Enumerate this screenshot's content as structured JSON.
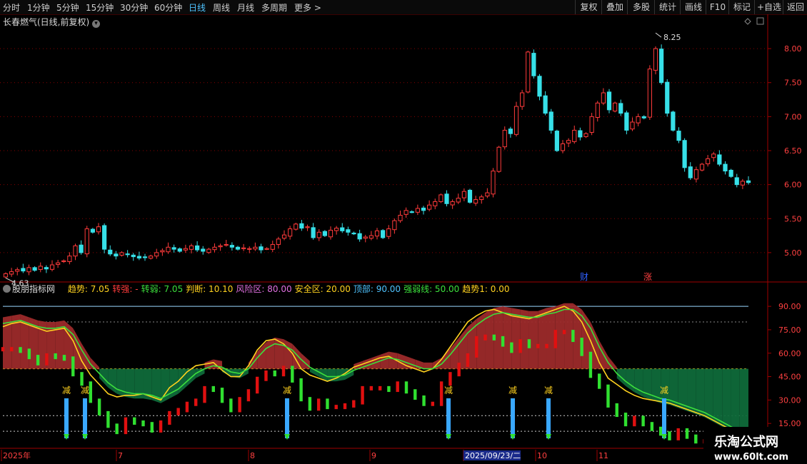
{
  "toolbar": {
    "left": [
      "分时",
      "1分钟",
      "5分钟",
      "15分钟",
      "30分钟",
      "60分钟",
      "日线",
      "周线",
      "月线",
      "多周期",
      "更多 >"
    ],
    "active": "日线",
    "right": [
      "复权",
      "叠加",
      "多股",
      "统计",
      "画线",
      "F10",
      "标记",
      "+自选",
      "返回"
    ]
  },
  "stock": {
    "title": "长春燃气(日线,前复权)"
  },
  "price_panel": {
    "yticks": [
      "8.00",
      "7.50",
      "7.00",
      "6.50",
      "6.00",
      "5.50",
      "5.00"
    ],
    "max_label": "8.25",
    "min_label": "4.63",
    "tags": [
      "财",
      "涨"
    ]
  },
  "indicator": {
    "name": "股朋指标网",
    "labels": [
      {
        "text": "趋势: 7.05",
        "color": "#ffd21f"
      },
      {
        "text": "转强: -",
        "color": "#ff3b3b"
      },
      {
        "text": "转弱: 7.05",
        "color": "#3ce03c"
      },
      {
        "text": "判断: 10.10",
        "color": "#ffd21f"
      },
      {
        "text": "风险区: 80.00",
        "color": "#e070e0"
      },
      {
        "text": "安全区: 20.00",
        "color": "#ffd21f"
      },
      {
        "text": "顶部: 90.00",
        "color": "#4fc3ff"
      },
      {
        "text": "强弱线: 50.00",
        "color": "#3ce03c"
      },
      {
        "text": "趋势1: 0.00",
        "color": "#ffd21f"
      }
    ],
    "yticks": [
      "90.00",
      "75.00",
      "60.00",
      "45.00",
      "30.00",
      "15.00"
    ],
    "signal_label": "减"
  },
  "time_axis": [
    "2025年",
    "7",
    "8",
    "9",
    "2025/09/23/二",
    "10",
    "11"
  ],
  "watermark": {
    "title": "乐淘公式网",
    "url": "www.60lt.com"
  },
  "chart_data": [
    {
      "type": "candlestick",
      "title": "长春燃气(日线,前复权)",
      "ylim": [
        4.6,
        8.4
      ],
      "close": [
        4.69,
        4.72,
        4.75,
        4.73,
        4.78,
        4.74,
        4.8,
        4.76,
        4.82,
        4.85,
        4.88,
        4.95,
        5.1,
        5.0,
        5.35,
        5.3,
        5.38,
        5.05,
        4.98,
        4.95,
        5.0,
        4.97,
        4.94,
        4.92,
        4.93,
        4.95,
        5.0,
        5.03,
        5.08,
        5.05,
        5.02,
        5.06,
        5.1,
        5.04,
        5.02,
        5.05,
        5.08,
        5.1,
        5.12,
        5.08,
        5.05,
        5.07,
        5.06,
        5.08,
        5.04,
        5.06,
        5.12,
        5.2,
        5.26,
        5.35,
        5.42,
        5.36,
        5.38,
        5.22,
        5.3,
        5.25,
        5.33,
        5.36,
        5.32,
        5.3,
        5.28,
        5.2,
        5.23,
        5.25,
        5.32,
        5.22,
        5.35,
        5.47,
        5.55,
        5.62,
        5.6,
        5.65,
        5.62,
        5.7,
        5.75,
        5.85,
        5.72,
        5.75,
        5.8,
        5.9,
        5.74,
        5.78,
        5.82,
        5.88,
        6.2,
        6.55,
        6.8,
        6.75,
        7.15,
        7.35,
        7.95,
        7.6,
        7.3,
        7.05,
        6.8,
        6.5,
        6.6,
        6.65,
        6.8,
        6.7,
        6.75,
        7.0,
        7.2,
        7.35,
        7.1,
        7.2,
        7.05,
        6.8,
        6.92,
        7.0,
        6.98,
        7.7,
        8.0,
        7.5,
        7.05,
        6.8,
        6.65,
        6.25,
        6.1,
        6.22,
        6.3,
        6.38,
        6.45,
        6.3,
        6.2,
        6.12,
        6.0,
        6.05,
        6.03
      ],
      "color_up": "#ff3b3b",
      "color_down": "#37e0e8"
    },
    {
      "type": "line",
      "title": "股朋指标网",
      "ylim": [
        0,
        96
      ],
      "reference_lines": [
        {
          "name": "顶部",
          "value": 90
        },
        {
          "name": "风险区",
          "value": 80
        },
        {
          "name": "强弱线",
          "value": 50
        },
        {
          "name": "安全区",
          "value": 20
        }
      ],
      "series": [
        {
          "name": "趋势",
          "color": "#ffd21f",
          "values": [
            77,
            79,
            80,
            78,
            76,
            74,
            75,
            76,
            68,
            55,
            46,
            40,
            34,
            32,
            33,
            33,
            34,
            32,
            30,
            38,
            42,
            48,
            52,
            53,
            54,
            49,
            45,
            45,
            52,
            62,
            68,
            69,
            66,
            60,
            50,
            46,
            44,
            42,
            44,
            47,
            51,
            53,
            55,
            57,
            58,
            55,
            52,
            50,
            48,
            50,
            56,
            64,
            72,
            80,
            84,
            87,
            88,
            86,
            84,
            83,
            82,
            84,
            86,
            88,
            90,
            87,
            80,
            68,
            54,
            44,
            40,
            36,
            33,
            31,
            30,
            29,
            28,
            26,
            24,
            22,
            20,
            17,
            14,
            11,
            8,
            4
          ]
        },
        {
          "name": "转弱",
          "color": "#3ce03c",
          "values": [
            79,
            80,
            81,
            79,
            77,
            76,
            76,
            77,
            72,
            62,
            53,
            47,
            41,
            37,
            35,
            34,
            34,
            33,
            31,
            34,
            37,
            42,
            47,
            50,
            52,
            51,
            48,
            47,
            50,
            57,
            63,
            66,
            65,
            62,
            56,
            51,
            48,
            45,
            45,
            46,
            49,
            51,
            53,
            55,
            57,
            56,
            54,
            52,
            50,
            50,
            53,
            59,
            66,
            73,
            78,
            82,
            85,
            86,
            85,
            84,
            83,
            83,
            85,
            86,
            88,
            88,
            84,
            76,
            64,
            54,
            47,
            42,
            38,
            35,
            33,
            31,
            30,
            28,
            26,
            24,
            22,
            19,
            16,
            13,
            10,
            6
          ]
        }
      ],
      "columns": "红绿柱 (判断)",
      "signals": [
        {
          "label": "减",
          "count": 7
        }
      ]
    }
  ]
}
